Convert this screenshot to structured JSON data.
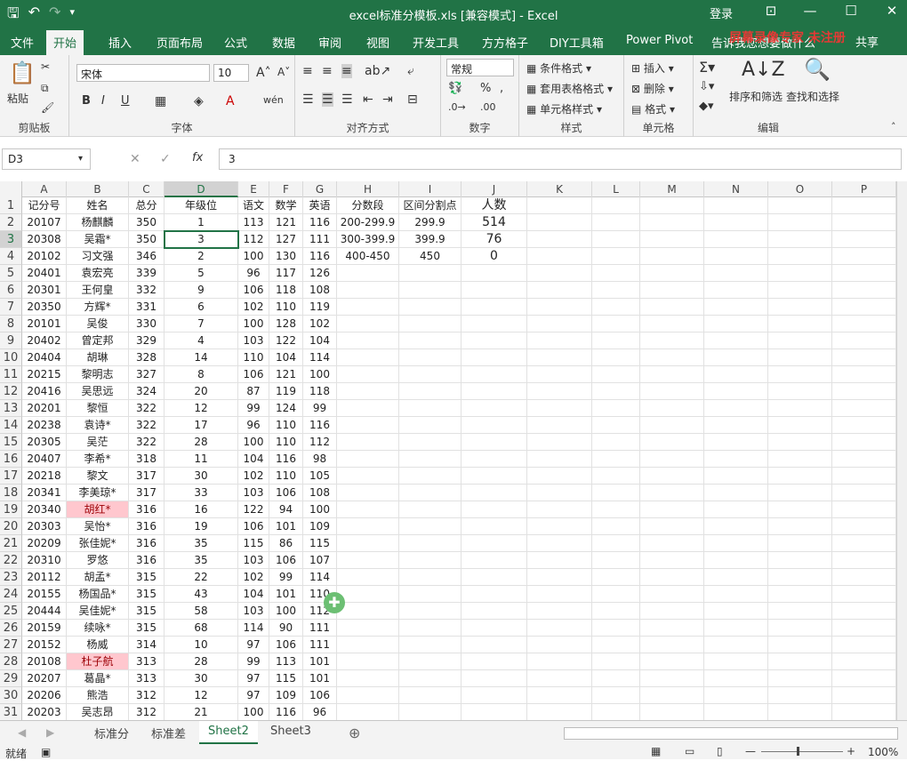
{
  "window": {
    "title": "excel标准分模板.xls [兼容模式] - Excel",
    "login": "登录",
    "share": "共享",
    "tellme": "告诉我您想要做什么",
    "overlay_text": "屏幕录像专家 未注册"
  },
  "ribbon_tabs": [
    "文件",
    "开始",
    "插入",
    "页面布局",
    "公式",
    "数据",
    "审阅",
    "视图",
    "开发工具",
    "方方格子",
    "DIY工具箱",
    "Power Pivot"
  ],
  "ribbon": {
    "clipboard": {
      "label": "剪贴板",
      "paste": "粘贴"
    },
    "font": {
      "label": "字体",
      "name": "宋体",
      "size": "10"
    },
    "alignment": {
      "label": "对齐方式"
    },
    "number": {
      "label": "数字",
      "format": "常规"
    },
    "styles": {
      "label": "样式",
      "cond": "条件格式",
      "table": "套用表格格式",
      "cell": "单元格样式"
    },
    "cells": {
      "label": "单元格",
      "insert": "插入",
      "delete": "删除",
      "format": "格式"
    },
    "editing": {
      "label": "编辑",
      "sort": "排序和筛选",
      "find": "查找和选择"
    }
  },
  "formula_bar": {
    "name_box": "D3",
    "fx": "fx",
    "formula": "3"
  },
  "columns": [
    "A",
    "B",
    "C",
    "D",
    "E",
    "F",
    "G",
    "H",
    "I",
    "J",
    "K",
    "L",
    "M",
    "N",
    "O",
    "P"
  ],
  "rows": [
    [
      "记分号",
      "姓名",
      "总分",
      "年级位",
      "语文",
      "数学",
      "英语",
      "分数段",
      "区间分割点",
      "人数"
    ],
    [
      "20107",
      "杨麒麟",
      "350",
      "1",
      "113",
      "121",
      "116",
      "200-299.9",
      "299.9",
      "514"
    ],
    [
      "20308",
      "吴霜*",
      "350",
      "3",
      "112",
      "127",
      "111",
      "300-399.9",
      "399.9",
      "76"
    ],
    [
      "20102",
      "习文强",
      "346",
      "2",
      "100",
      "130",
      "116",
      "400-450",
      "450",
      "0"
    ],
    [
      "20401",
      "袁宏亮",
      "339",
      "5",
      "96",
      "117",
      "126"
    ],
    [
      "20301",
      "王何皇",
      "332",
      "9",
      "106",
      "118",
      "108"
    ],
    [
      "20350",
      "方辉*",
      "331",
      "6",
      "102",
      "110",
      "119"
    ],
    [
      "20101",
      "吴俊",
      "330",
      "7",
      "100",
      "128",
      "102"
    ],
    [
      "20402",
      "曾定邦",
      "329",
      "4",
      "103",
      "122",
      "104"
    ],
    [
      "20404",
      "胡琳",
      "328",
      "14",
      "110",
      "104",
      "114"
    ],
    [
      "20215",
      "黎明志",
      "327",
      "8",
      "106",
      "121",
      "100"
    ],
    [
      "20416",
      "吴思远",
      "324",
      "20",
      "87",
      "119",
      "118"
    ],
    [
      "20201",
      "黎恒",
      "322",
      "12",
      "99",
      "124",
      "99"
    ],
    [
      "20238",
      "袁诗*",
      "322",
      "17",
      "96",
      "110",
      "116"
    ],
    [
      "20305",
      "吴茫",
      "322",
      "28",
      "100",
      "110",
      "112"
    ],
    [
      "20407",
      "李希*",
      "318",
      "11",
      "104",
      "116",
      "98"
    ],
    [
      "20218",
      "黎文",
      "317",
      "30",
      "102",
      "110",
      "105"
    ],
    [
      "20341",
      "李美琼*",
      "317",
      "33",
      "103",
      "106",
      "108"
    ],
    [
      "20340",
      "胡红*",
      "316",
      "16",
      "122",
      "94",
      "100"
    ],
    [
      "20303",
      "吴怡*",
      "316",
      "19",
      "106",
      "101",
      "109"
    ],
    [
      "20209",
      "张佳妮*",
      "316",
      "35",
      "115",
      "86",
      "115"
    ],
    [
      "20310",
      "罗悠",
      "316",
      "35",
      "103",
      "106",
      "107"
    ],
    [
      "20112",
      "胡孟*",
      "315",
      "22",
      "102",
      "99",
      "114"
    ],
    [
      "20155",
      "杨国品*",
      "315",
      "43",
      "104",
      "101",
      "110"
    ],
    [
      "20444",
      "吴佳妮*",
      "315",
      "58",
      "103",
      "100",
      "112"
    ],
    [
      "20159",
      "续咏*",
      "315",
      "68",
      "114",
      "90",
      "111"
    ],
    [
      "20152",
      "杨威",
      "314",
      "10",
      "97",
      "106",
      "111"
    ],
    [
      "20108",
      "杜子航",
      "313",
      "28",
      "99",
      "113",
      "101"
    ],
    [
      "20207",
      "葛晶*",
      "313",
      "30",
      "97",
      "115",
      "101"
    ],
    [
      "20206",
      "熊浩",
      "312",
      "12",
      "97",
      "109",
      "106"
    ],
    [
      "20203",
      "吴志昂",
      "312",
      "21",
      "100",
      "116",
      "96"
    ]
  ],
  "sheets": [
    "标准分",
    "标准差",
    "Sheet2",
    "Sheet3"
  ],
  "status": {
    "ready": "就绪",
    "zoom": "100%"
  }
}
